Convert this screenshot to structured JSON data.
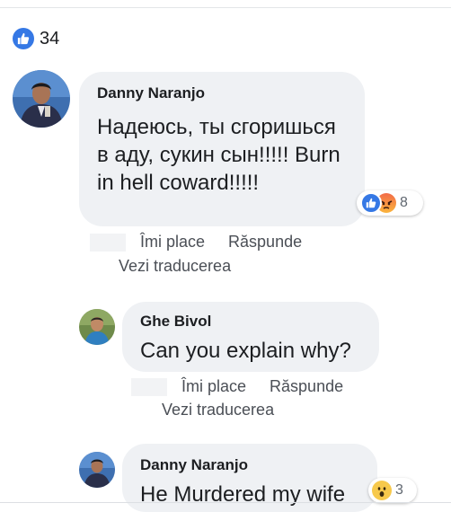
{
  "colors": {
    "facebook_blue": "#3578e5",
    "bubble_bg": "#eff1f4",
    "meta_text": "#4b4f56"
  },
  "reactions_summary": {
    "icon": "like-icon",
    "count": "34"
  },
  "comments": [
    {
      "author": "Danny Naranjo",
      "text": "Надеюсь, ты сгоришься в аду, сукин сын!!!!! Burn in hell coward!!!!!",
      "reactions": {
        "icons": [
          "like-icon",
          "angry-icon"
        ],
        "count": "8"
      },
      "actions": {
        "like": "Îmi place",
        "reply": "Răspunde"
      },
      "translate": "Vezi traducerea"
    },
    {
      "author": "Ghe Bivol",
      "text": "Can you explain why?",
      "actions": {
        "like": "Îmi place",
        "reply": "Răspunde"
      },
      "translate": "Vezi traducerea"
    },
    {
      "author": "Danny Naranjo",
      "text": "He Murdered my wife",
      "reactions": {
        "icons": [
          "wow-icon"
        ],
        "count": "3"
      }
    }
  ]
}
